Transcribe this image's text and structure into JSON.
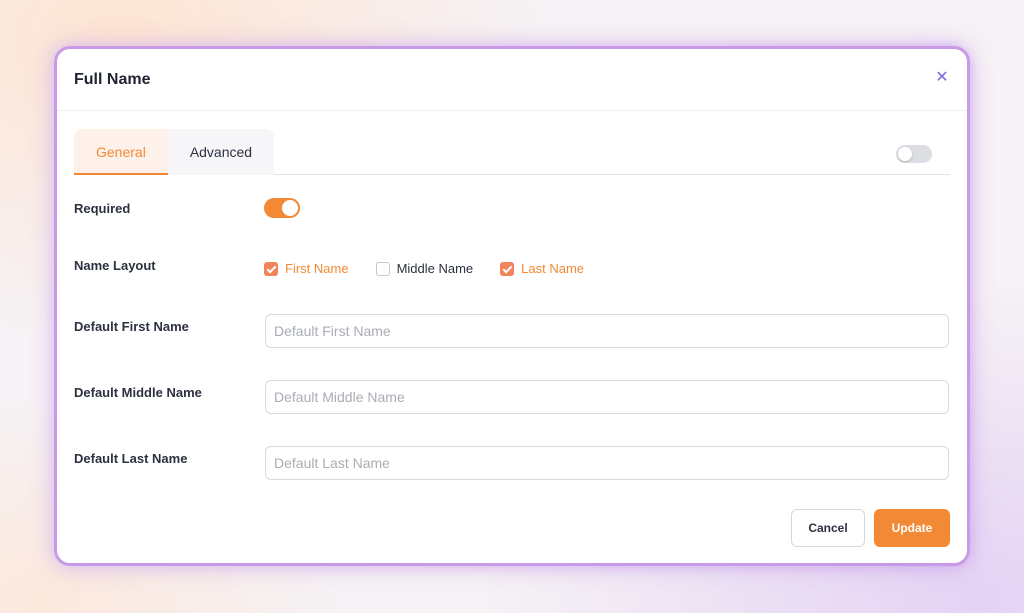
{
  "dialog": {
    "title": "Full Name",
    "close_icon": "close-icon"
  },
  "tabs": [
    {
      "label": "General",
      "active": true
    },
    {
      "label": "Advanced",
      "active": false
    }
  ],
  "tab_toggle": {
    "on": false
  },
  "fields": {
    "required": {
      "label": "Required",
      "on": true
    },
    "name_layout": {
      "label": "Name Layout",
      "options": [
        {
          "label": "First Name",
          "checked": true
        },
        {
          "label": "Middle Name",
          "checked": false
        },
        {
          "label": "Last Name",
          "checked": true
        }
      ]
    },
    "default_first": {
      "label": "Default First Name",
      "placeholder": "Default First Name",
      "value": ""
    },
    "default_middle": {
      "label": "Default Middle Name",
      "placeholder": "Default Middle Name",
      "value": ""
    },
    "default_last": {
      "label": "Default Last Name",
      "placeholder": "Default Last Name",
      "value": ""
    }
  },
  "footer": {
    "cancel_label": "Cancel",
    "update_label": "Update"
  },
  "colors": {
    "accent": "#f28a35",
    "checkbox_checked": "#f0845a",
    "modal_border": "#c89ae8",
    "close_icon": "#7a6ad8"
  }
}
